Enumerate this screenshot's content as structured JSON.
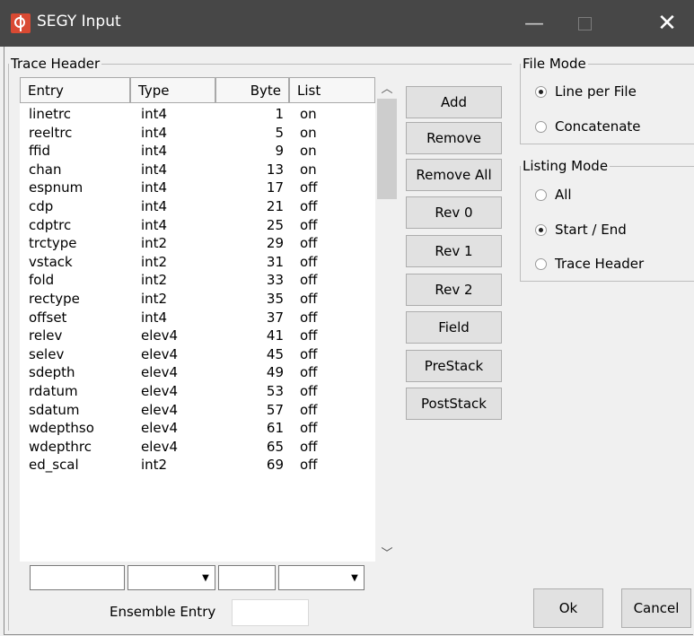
{
  "window": {
    "title": "SEGY Input",
    "minimize": "—",
    "close": "✕"
  },
  "trace_header": {
    "legend": "Trace Header",
    "columns": {
      "entry": "Entry",
      "type": "Type",
      "byte": "Byte",
      "list": "List"
    },
    "rows": [
      {
        "entry": "linetrc",
        "type": "int4",
        "byte": "1",
        "list": "on"
      },
      {
        "entry": "reeltrc",
        "type": "int4",
        "byte": "5",
        "list": "on"
      },
      {
        "entry": "ffid",
        "type": "int4",
        "byte": "9",
        "list": "on"
      },
      {
        "entry": "chan",
        "type": "int4",
        "byte": "13",
        "list": "on"
      },
      {
        "entry": "espnum",
        "type": "int4",
        "byte": "17",
        "list": "off"
      },
      {
        "entry": "cdp",
        "type": "int4",
        "byte": "21",
        "list": "off"
      },
      {
        "entry": "cdptrc",
        "type": "int4",
        "byte": "25",
        "list": "off"
      },
      {
        "entry": "trctype",
        "type": "int2",
        "byte": "29",
        "list": "off"
      },
      {
        "entry": "vstack",
        "type": "int2",
        "byte": "31",
        "list": "off"
      },
      {
        "entry": "fold",
        "type": "int2",
        "byte": "33",
        "list": "off"
      },
      {
        "entry": "rectype",
        "type": "int2",
        "byte": "35",
        "list": "off"
      },
      {
        "entry": "offset",
        "type": "int4",
        "byte": "37",
        "list": "off"
      },
      {
        "entry": "relev",
        "type": "elev4",
        "byte": "41",
        "list": "off"
      },
      {
        "entry": "selev",
        "type": "elev4",
        "byte": "45",
        "list": "off"
      },
      {
        "entry": "sdepth",
        "type": "elev4",
        "byte": "49",
        "list": "off"
      },
      {
        "entry": "rdatum",
        "type": "elev4",
        "byte": "53",
        "list": "off"
      },
      {
        "entry": "sdatum",
        "type": "elev4",
        "byte": "57",
        "list": "off"
      },
      {
        "entry": "wdepthso",
        "type": "elev4",
        "byte": "61",
        "list": "off"
      },
      {
        "entry": "wdepthrc",
        "type": "elev4",
        "byte": "65",
        "list": "off"
      },
      {
        "entry": "ed_scal",
        "type": "int2",
        "byte": "69",
        "list": "off"
      }
    ],
    "ensemble_label": "Ensemble Entry"
  },
  "buttons": [
    "Add",
    "Remove",
    "Remove All",
    "Rev 0",
    "Rev 1",
    "Rev 2",
    "Field",
    "PreStack",
    "PostStack"
  ],
  "file_mode": {
    "legend": "File Mode",
    "options": [
      {
        "label": "Line per File",
        "selected": true
      },
      {
        "label": "Concatenate",
        "selected": false
      }
    ]
  },
  "listing_mode": {
    "legend": "Listing Mode",
    "options": [
      {
        "label": "All",
        "selected": false
      },
      {
        "label": "Start / End",
        "selected": true
      },
      {
        "label": "Trace Header",
        "selected": false
      }
    ]
  },
  "footer": {
    "ok": "Ok",
    "cancel": "Cancel"
  }
}
